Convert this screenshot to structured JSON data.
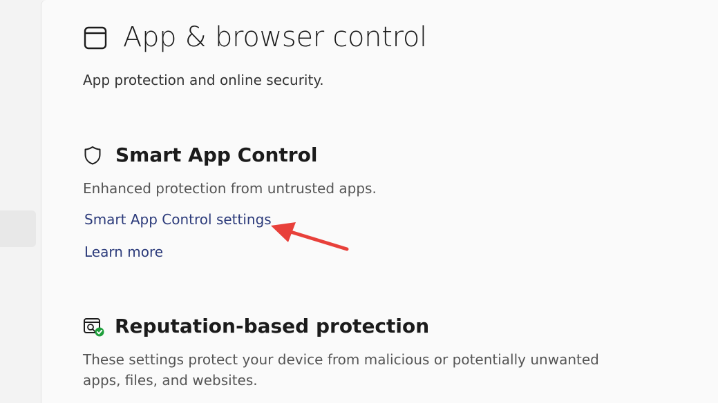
{
  "page": {
    "title": "App & browser control",
    "subtitle": "App protection and online security.",
    "icon": "app-window-icon"
  },
  "sections": [
    {
      "title": "Smart App Control",
      "icon": "shield-icon",
      "description": "Enhanced protection from untrusted apps.",
      "links": [
        {
          "label": "Smart App Control settings"
        },
        {
          "label": "Learn more"
        }
      ]
    },
    {
      "title": "Reputation-based protection",
      "icon": "reputation-shield-check-icon",
      "description": "These settings protect your device from malicious or potentially unwanted apps, files, and websites."
    }
  ],
  "annotation": {
    "arrow_color": "#e8403a",
    "icon": "red-arrow-icon"
  },
  "colors": {
    "link": "#2b3a7a",
    "check_badge": "#1e9e3b"
  }
}
